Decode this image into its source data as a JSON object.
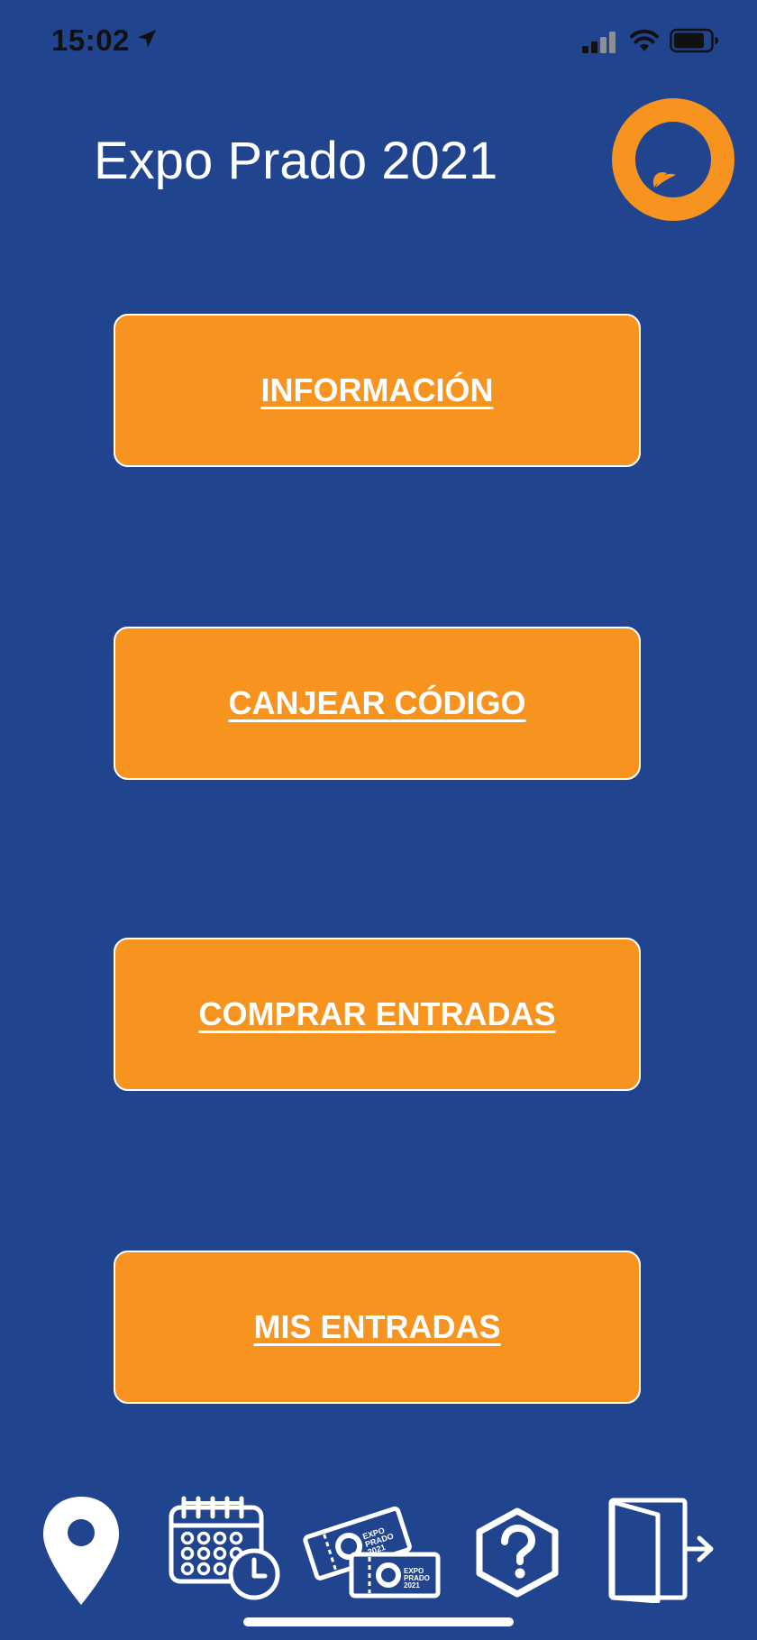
{
  "status_bar": {
    "time": "15:02",
    "icons": [
      "location-arrow-icon",
      "cellular-signal-icon",
      "wifi-icon",
      "battery-icon"
    ]
  },
  "header": {
    "title": "Expo Prado 2021",
    "logo_icon": "expo-prado-logo-icon"
  },
  "menu": {
    "buttons": [
      {
        "label": "INFORMACIÓN"
      },
      {
        "label": "CANJEAR CÓDIGO"
      },
      {
        "label": "COMPRAR ENTRADAS"
      },
      {
        "label": "MIS ENTRADAS"
      }
    ]
  },
  "tab_bar": {
    "tabs": [
      {
        "icon": "map-pin-icon"
      },
      {
        "icon": "calendar-clock-icon"
      },
      {
        "icon": "tickets-icon"
      },
      {
        "icon": "help-hexagon-icon"
      },
      {
        "icon": "exit-door-icon"
      }
    ],
    "ticket_text": [
      "EXPO",
      "PRADO",
      "2021"
    ]
  },
  "colors": {
    "background": "#21448f",
    "button": "#f7931f",
    "logo_ring": "#f7931f",
    "text": "#ffffff"
  }
}
